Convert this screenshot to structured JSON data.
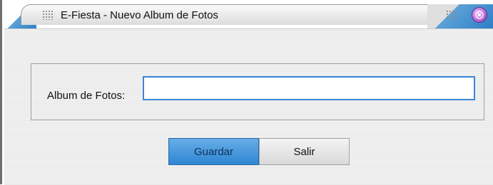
{
  "window": {
    "title": "E-Fiesta - Nuevo Album de Fotos"
  },
  "form": {
    "album_label": "Album de Fotos:",
    "album_value": "",
    "album_placeholder": ""
  },
  "buttons": {
    "save_label": "Guardar",
    "exit_label": "Salir"
  },
  "colors": {
    "accent": "#2f86d2",
    "close_button": "#b56ad6",
    "input_border": "#3a86d6"
  }
}
